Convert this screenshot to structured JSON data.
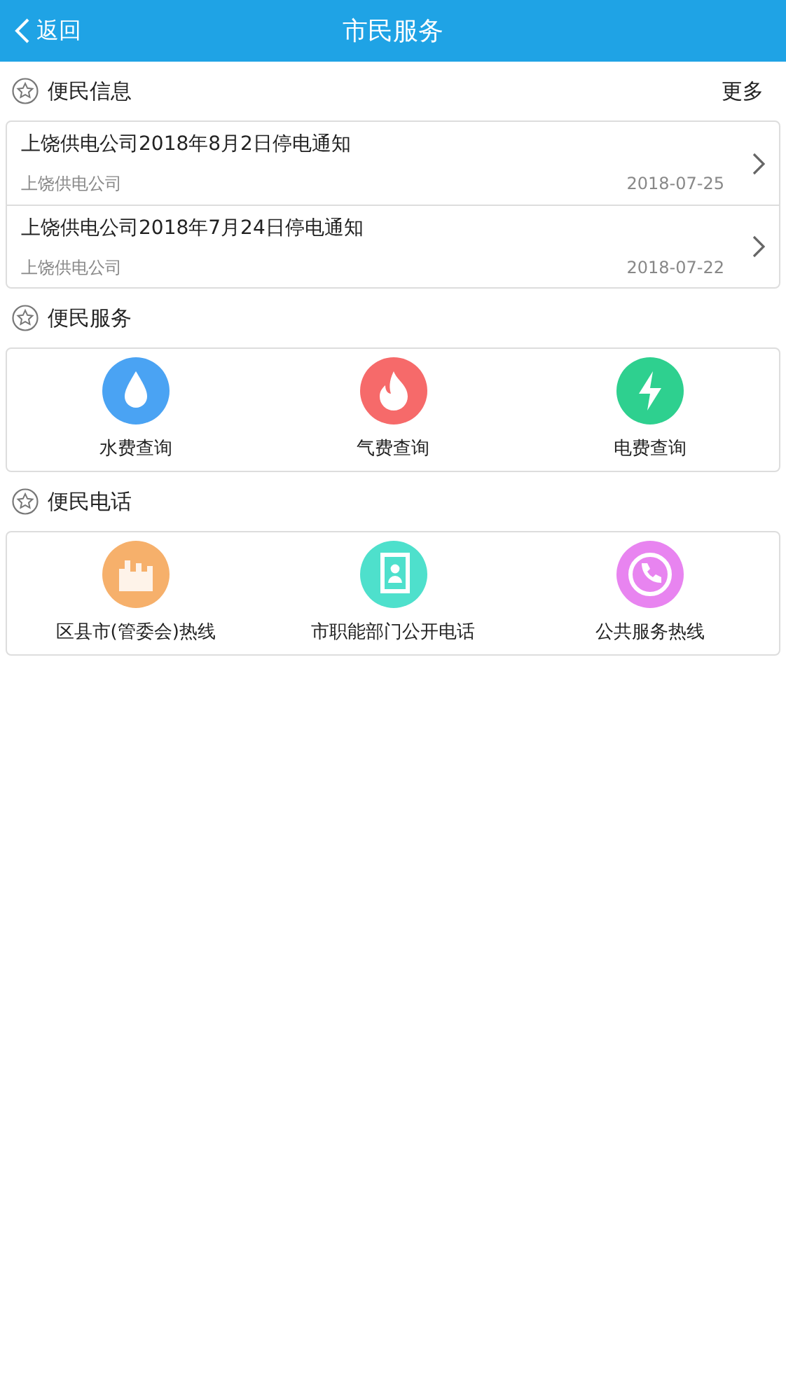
{
  "header": {
    "back": "返回",
    "title": "市民服务"
  },
  "info": {
    "title": "便民信息",
    "more": "更多",
    "items": [
      {
        "title": "上饶供电公司2018年8月2日停电通知",
        "source": "上饶供电公司",
        "date": "2018-07-25"
      },
      {
        "title": "上饶供电公司2018年7月24日停电通知",
        "source": "上饶供电公司",
        "date": "2018-07-22"
      }
    ]
  },
  "services": {
    "title": "便民服务",
    "items": [
      {
        "label": "水费查询",
        "kind": "water",
        "color": "#4aa3f3"
      },
      {
        "label": "气费查询",
        "kind": "gas",
        "color": "#f66a6a"
      },
      {
        "label": "电费查询",
        "kind": "power",
        "color": "#2ed08f"
      }
    ]
  },
  "phones": {
    "title": "便民电话",
    "items": [
      {
        "label": "区县市(管委会)热线",
        "kind": "city",
        "color": "#f6b06b"
      },
      {
        "label": "市职能部门公开电话",
        "kind": "doc",
        "color": "#4ee0cc"
      },
      {
        "label": "公共服务热线",
        "kind": "phone",
        "color": "#e884f0"
      }
    ]
  }
}
